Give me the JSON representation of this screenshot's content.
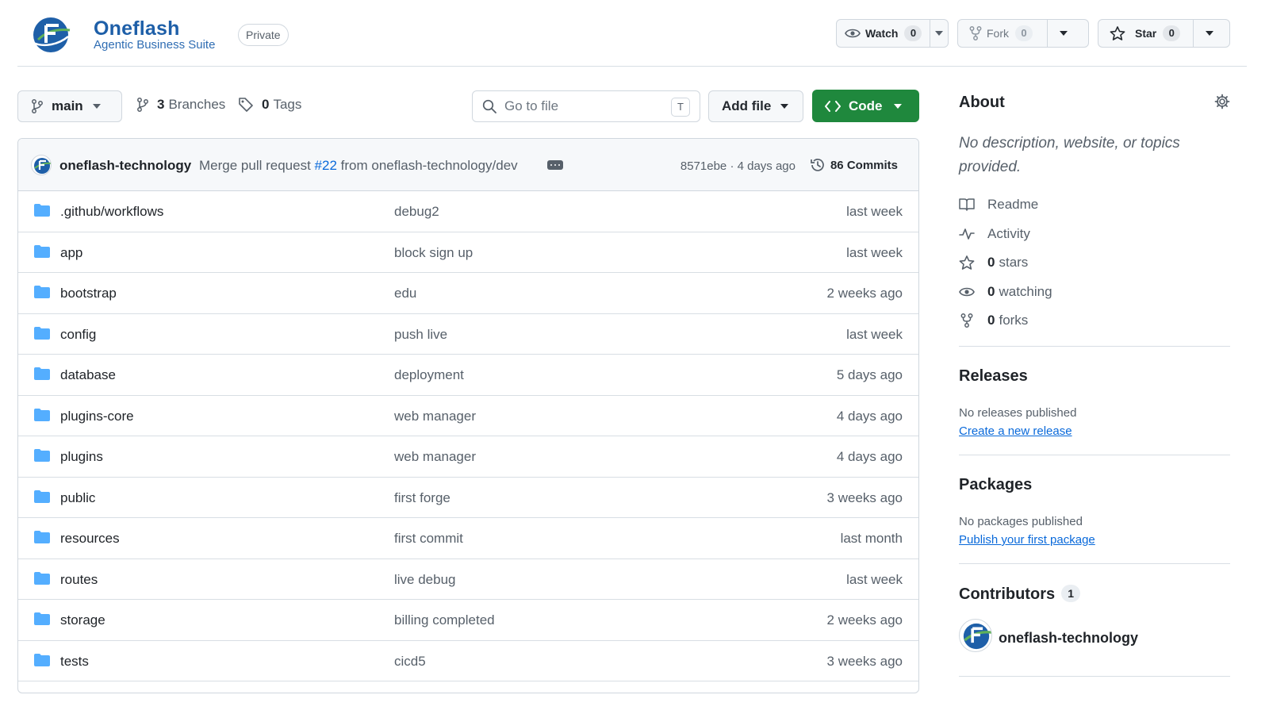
{
  "header": {
    "brand_name": "Oneflash",
    "brand_sub": "Agentic Business Suite",
    "visibility": "Private",
    "watch": {
      "label": "Watch",
      "count": "0"
    },
    "fork": {
      "label": "Fork",
      "count": "0"
    },
    "star": {
      "label": "Star",
      "count": "0"
    }
  },
  "toolbar": {
    "branch": "main",
    "branches_count": "3",
    "branches_label": "Branches",
    "tags_count": "0",
    "tags_label": "Tags",
    "goto_placeholder": "Go to file",
    "goto_shortcut": "T",
    "add_file": "Add file",
    "code": "Code"
  },
  "commit": {
    "author": "oneflash-technology",
    "message_prefix": "Merge pull request",
    "pr": "#22",
    "message_suffix": "from oneflash-technology/dev",
    "sha_age": "8571ebe · 4 days ago",
    "commits": "86 Commits"
  },
  "files": [
    {
      "name": ".github/workflows",
      "message": "debug2",
      "date": "last week"
    },
    {
      "name": "app",
      "message": "block sign up",
      "date": "last week"
    },
    {
      "name": "bootstrap",
      "message": "edu",
      "date": "2 weeks ago"
    },
    {
      "name": "config",
      "message": "push live",
      "date": "last week"
    },
    {
      "name": "database",
      "message": "deployment",
      "date": "5 days ago"
    },
    {
      "name": "plugins-core",
      "message": "web manager",
      "date": "4 days ago"
    },
    {
      "name": "plugins",
      "message": "web manager",
      "date": "4 days ago"
    },
    {
      "name": "public",
      "message": "first forge",
      "date": "3 weeks ago"
    },
    {
      "name": "resources",
      "message": "first commit",
      "date": "last month"
    },
    {
      "name": "routes",
      "message": "live debug",
      "date": "last week"
    },
    {
      "name": "storage",
      "message": "billing completed",
      "date": "2 weeks ago"
    },
    {
      "name": "tests",
      "message": "cicd5",
      "date": "3 weeks ago"
    }
  ],
  "sidebar": {
    "about_title": "About",
    "description": "No description, website, or topics provided.",
    "readme": "Readme",
    "activity": "Activity",
    "stars_count": "0",
    "stars_label": "stars",
    "watching_count": "0",
    "watching_label": "watching",
    "forks_count": "0",
    "forks_label": "forks",
    "releases_title": "Releases",
    "releases_note": "No releases published",
    "releases_link": "Create a new release",
    "packages_title": "Packages",
    "packages_note": "No packages published",
    "packages_link": "Publish your first package",
    "contributors_title": "Contributors",
    "contributors_count": "1",
    "contributor_name": "oneflash-technology"
  },
  "colors": {
    "accent": "#0969da",
    "code_button": "#1f883d",
    "folder": "#54aeff",
    "brand": "#1e5fa8"
  }
}
